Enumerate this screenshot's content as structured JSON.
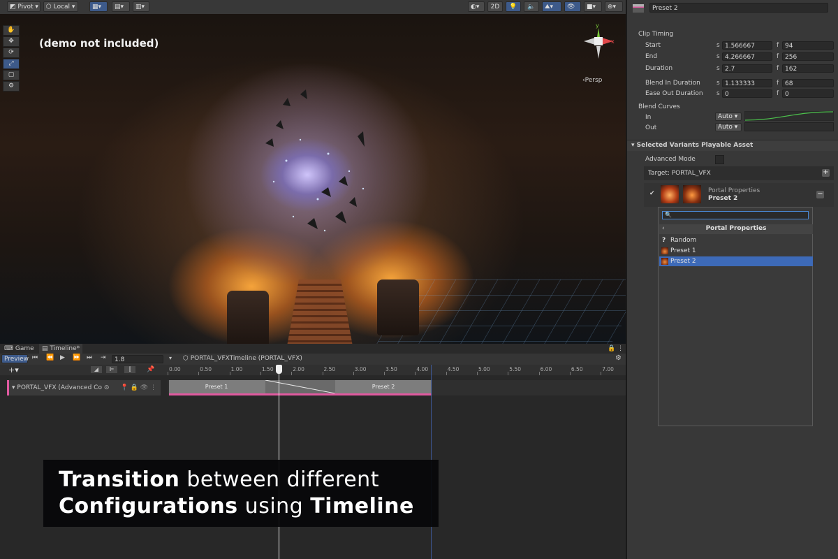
{
  "scene_toolbar": {
    "pivot": "Pivot",
    "local": "Local",
    "mode_2d": "2D"
  },
  "scene": {
    "demo_note": "(demo not included)",
    "persp": "Persp",
    "gizmo_axes": {
      "y": "y",
      "x": "x"
    }
  },
  "timeline": {
    "tabs": {
      "game": "Game",
      "timeline": "Timeline*"
    },
    "preview": "Preview",
    "frame_value": "1.8",
    "asset_path": "PORTAL_VFXTimeline (PORTAL_VFX)",
    "ruler_ticks": [
      "0.00",
      "0.50",
      "1.00",
      "1.50",
      "2.00",
      "2.50",
      "3.00",
      "3.50",
      "4.00",
      "4.50",
      "5.00",
      "5.50",
      "6.00",
      "6.50",
      "7.00"
    ],
    "track_name": "PORTAL_VFX (Advanced Co",
    "clips": [
      {
        "label": "Preset 1"
      },
      {
        "label": "Preset 2"
      }
    ]
  },
  "caption": {
    "line1_bold": "Transition",
    "line1_rest": " between different",
    "line2_bold1": "Configurations",
    "line2_mid": " using ",
    "line2_bold2": "Timeline"
  },
  "inspector": {
    "clip_name": "Preset 2",
    "clip_timing_header": "Clip Timing",
    "rows": [
      {
        "label": "Start",
        "s": "1.566667",
        "f": "94"
      },
      {
        "label": "End",
        "s": "4.266667",
        "f": "256"
      },
      {
        "label": "Duration",
        "s": "2.7",
        "f": "162"
      },
      {
        "label": "Blend In Duration",
        "s": "1.133333",
        "f": "68"
      },
      {
        "label": "Ease Out Duration",
        "s": "0",
        "f": "0"
      }
    ],
    "unit_s": "s",
    "unit_f": "f",
    "blend_curves_header": "Blend Curves",
    "blend_in_label": "In",
    "blend_out_label": "Out",
    "blend_in_value": "Auto",
    "blend_out_value": "Auto",
    "section_header": "Selected Variants Playable Asset",
    "advanced_mode": "Advanced Mode",
    "target_label": "Target: PORTAL_VFX",
    "variant_title": "Portal Properties",
    "variant_value": "Preset 2",
    "popup": {
      "search_placeholder": "",
      "title": "Portal Properties",
      "items": [
        {
          "label": "Random",
          "icon": "question-icon"
        },
        {
          "label": "Preset 1",
          "icon": "thumbnail-icon"
        },
        {
          "label": "Preset 2",
          "icon": "thumbnail-icon",
          "selected": true
        }
      ]
    }
  }
}
